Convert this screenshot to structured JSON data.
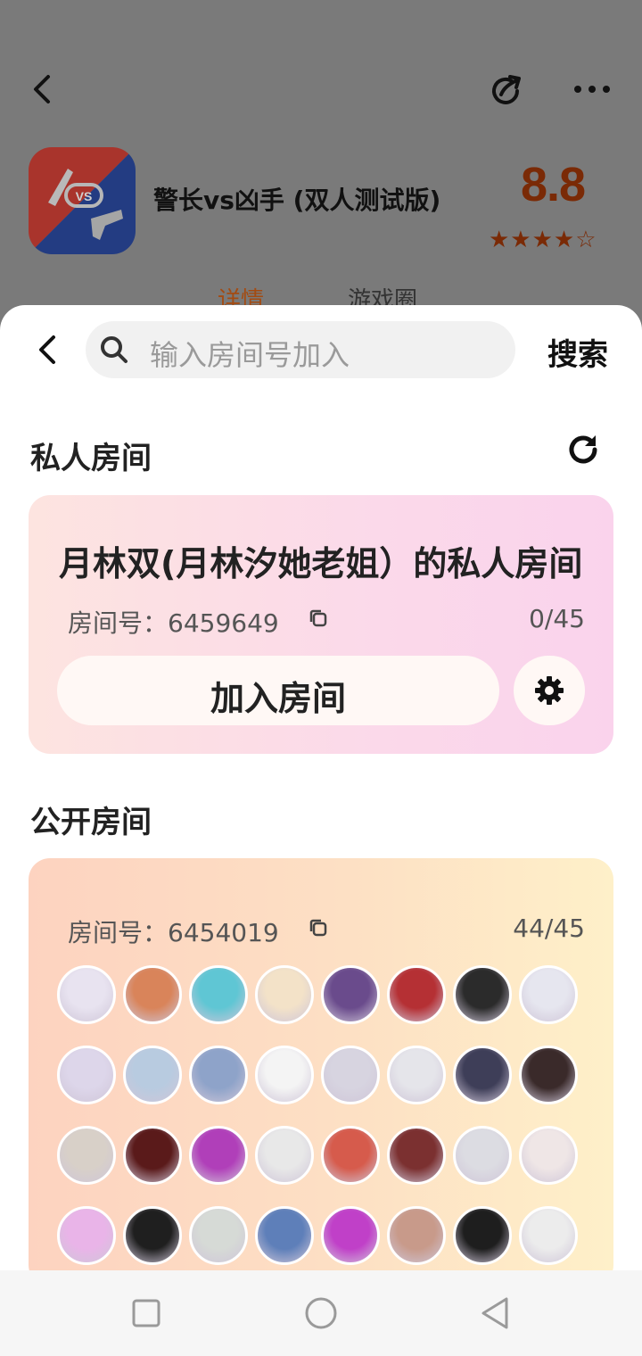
{
  "background_page": {
    "app_title": "警长vs凶手 (双人测试版)",
    "score": "8.8",
    "stars": "★★★★☆",
    "tabs": [
      "详情",
      "游戏圈"
    ],
    "icon_badge": "VS"
  },
  "search": {
    "placeholder": "输入房间号加入",
    "button": "搜索"
  },
  "private_section": {
    "title": "私人房间",
    "room_name": "月林双(月林汐她老姐）的私人房间",
    "room_label": "房间号：6459649",
    "count": "0/45",
    "join_button": "加入房间"
  },
  "public_section": {
    "title": "公开房间",
    "room_label": "房间号：6454019",
    "count": "44/45",
    "avatar_colors": [
      "#e8e3f0",
      "#d9845a",
      "#5fc6d4",
      "#f3e2c8",
      "#6a4b8c",
      "#b53034",
      "#2b2b2b",
      "#e6e6ef",
      "#ddd6ea",
      "#b8cbe0",
      "#8ea3c9",
      "#f4f4f4",
      "#d7d4e0",
      "#e5e5ea",
      "#3e3e58",
      "#3a2a2a",
      "#d8d0c8",
      "#5a1a1a",
      "#b03fb9",
      "#e8e8e8",
      "#d65b4c",
      "#7b3030",
      "#dcdce2",
      "#efe6e6",
      "#e9b4e8",
      "#1f1f1f",
      "#d6dad6",
      "#5e7fb9",
      "#c040c8",
      "#c89a8a",
      "#1e1e1e",
      "#ececec"
    ]
  },
  "nav": [
    "recent-apps",
    "home",
    "back"
  ]
}
